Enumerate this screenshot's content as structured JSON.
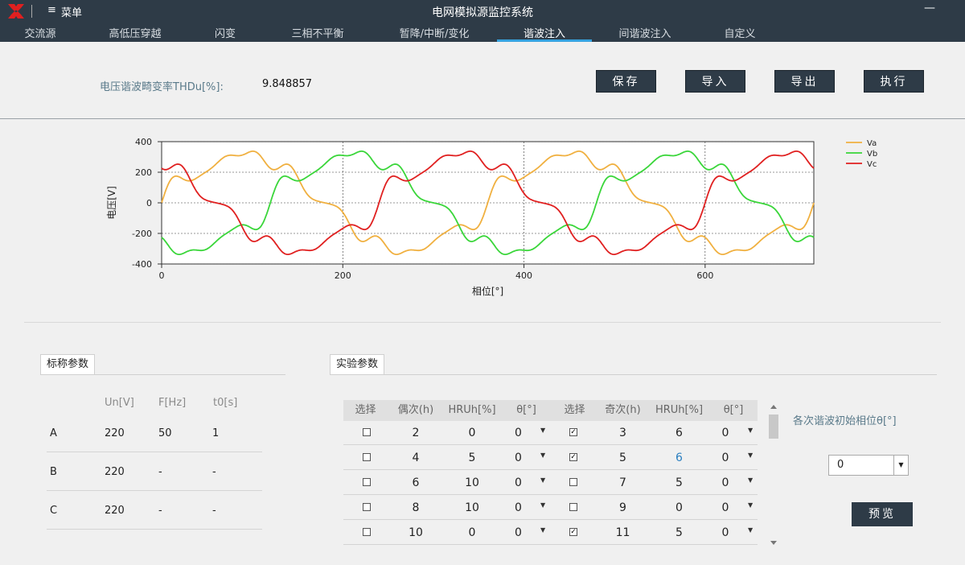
{
  "window": {
    "title": "电网模拟源监控系统",
    "menu_label": "菜单",
    "minimize": "—"
  },
  "tabs": [
    "交流源",
    "高低压穿越",
    "闪变",
    "三相不平衡",
    "暂降/中断/变化",
    "谐波注入",
    "间谐波注入",
    "自定义"
  ],
  "active_tab": "谐波注入",
  "thd": {
    "label": "电压谐波畸变率THDu[%]:",
    "value": "9.848857"
  },
  "buttons": {
    "save": "保存",
    "import": "导入",
    "export": "导出",
    "execute": "执行",
    "preview": "预览"
  },
  "colors": {
    "Va": "#f0b040",
    "Vb": "#3ad63a",
    "Vc": "#e02020",
    "dark": "#2e3b47",
    "accent": "#36a3e0"
  },
  "chart_data": {
    "type": "line",
    "ylabel": "电压[V]",
    "xlabel": "相位[°]",
    "xlim": [
      0,
      720
    ],
    "ylim": [
      -400,
      400
    ],
    "xticks": [
      0,
      200,
      400,
      600
    ],
    "yticks": [
      400,
      200,
      0,
      -200,
      -400
    ],
    "fundamental_amplitude": 311,
    "harmonics": [
      {
        "order": 4,
        "percent": 5
      },
      {
        "order": 5,
        "percent": 6
      },
      {
        "order": 6,
        "percent": 10
      },
      {
        "order": 8,
        "percent": 10
      },
      {
        "order": 11,
        "percent": 5
      }
    ],
    "series": [
      {
        "name": "Va",
        "phase_deg": 0
      },
      {
        "name": "Vb",
        "phase_deg": -120
      },
      {
        "name": "Vc",
        "phase_deg": 120
      }
    ],
    "grid": true,
    "legend": "top-right"
  },
  "nominal": {
    "title": "标称参数",
    "headers": [
      "Un[V]",
      "F[Hz]",
      "t0[s]"
    ],
    "rows": [
      {
        "phase": "A",
        "un": "220",
        "f": "50",
        "t0": "1"
      },
      {
        "phase": "B",
        "un": "220",
        "f": "-",
        "t0": "-"
      },
      {
        "phase": "C",
        "un": "220",
        "f": "-",
        "t0": "-"
      }
    ]
  },
  "experiment": {
    "title": "实验参数",
    "headers": [
      "选择",
      "偶次(h)",
      "HRUh[%]",
      "θ[°]",
      "选择",
      "奇次(h)",
      "HRUh[%]",
      "θ[°]"
    ],
    "rows": [
      {
        "sel_even": "",
        "even": "2",
        "even_hru": "0",
        "even_theta": "0",
        "sel_odd": "✓",
        "odd": "3",
        "odd_hru": "6",
        "odd_theta": "0"
      },
      {
        "sel_even": "",
        "even": "4",
        "even_hru": "5",
        "even_theta": "0",
        "sel_odd": "✓",
        "odd": "5",
        "odd_hru": "6",
        "odd_theta": "0"
      },
      {
        "sel_even": "",
        "even": "6",
        "even_hru": "10",
        "even_theta": "0",
        "sel_odd": "",
        "odd": "7",
        "odd_hru": "5",
        "odd_theta": "0"
      },
      {
        "sel_even": "",
        "even": "8",
        "even_hru": "10",
        "even_theta": "0",
        "sel_odd": "",
        "odd": "9",
        "odd_hru": "0",
        "odd_theta": "0"
      },
      {
        "sel_even": "",
        "even": "10",
        "even_hru": "0",
        "even_theta": "0",
        "sel_odd": "✓",
        "odd": "11",
        "odd_hru": "5",
        "odd_theta": "0"
      }
    ]
  },
  "init_phase": {
    "label": "各次谐波初始相位θ[°]",
    "value": "0"
  }
}
